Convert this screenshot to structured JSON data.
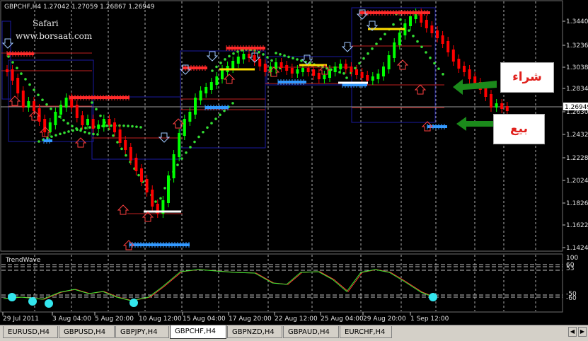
{
  "chart_header": "GBPCHF,H4  1.27042 1.27059 1.26867 1.26949",
  "watermark": {
    "title": "Safari",
    "url": "www.borsaat.com"
  },
  "price_axis": [
    "1.34400",
    "1.32360",
    "1.30380",
    "1.28340",
    "1.26300",
    "1.24320",
    "1.22280",
    "1.20240",
    "1.18260",
    "1.16220",
    "1.14240"
  ],
  "current_price": "1.26949",
  "subchart": {
    "title": "TrendWave",
    "levels": [
      "100",
      "60",
      "53",
      "-50",
      "-60"
    ]
  },
  "time_axis": [
    "29 Jul 2011",
    "3 Aug 04:00",
    "5 Aug 20:00",
    "10 Aug 12:00",
    "15 Aug 04:00",
    "17 Aug 20:00",
    "22 Aug 12:00",
    "25 Aug 04:00",
    "29 Aug 20:00",
    "1 Sep 12:00"
  ],
  "annotations": {
    "buy": "شراء",
    "sell": "بيع"
  },
  "tabs": [
    {
      "label": "EURUSD,H4",
      "active": false
    },
    {
      "label": "GBPUSD,H4",
      "active": false
    },
    {
      "label": "GBPJPY,H4",
      "active": false
    },
    {
      "label": "GBPCHF,H4",
      "active": true
    },
    {
      "label": "GBPNZD,H4",
      "active": false
    },
    {
      "label": "GBPAUD,H4",
      "active": false
    },
    {
      "label": "EURCHF,H4",
      "active": false
    }
  ],
  "colors": {
    "up_candle": "#00ff00",
    "down_candle": "#ff0000",
    "trend_dots": "#33dd33",
    "buy_marker": "#ff2a2a",
    "sell_marker": "#3399ff",
    "box": "#1a1aa0",
    "arrow_green": "#1b8a1b",
    "osc_circle": "#33e6ee"
  }
}
